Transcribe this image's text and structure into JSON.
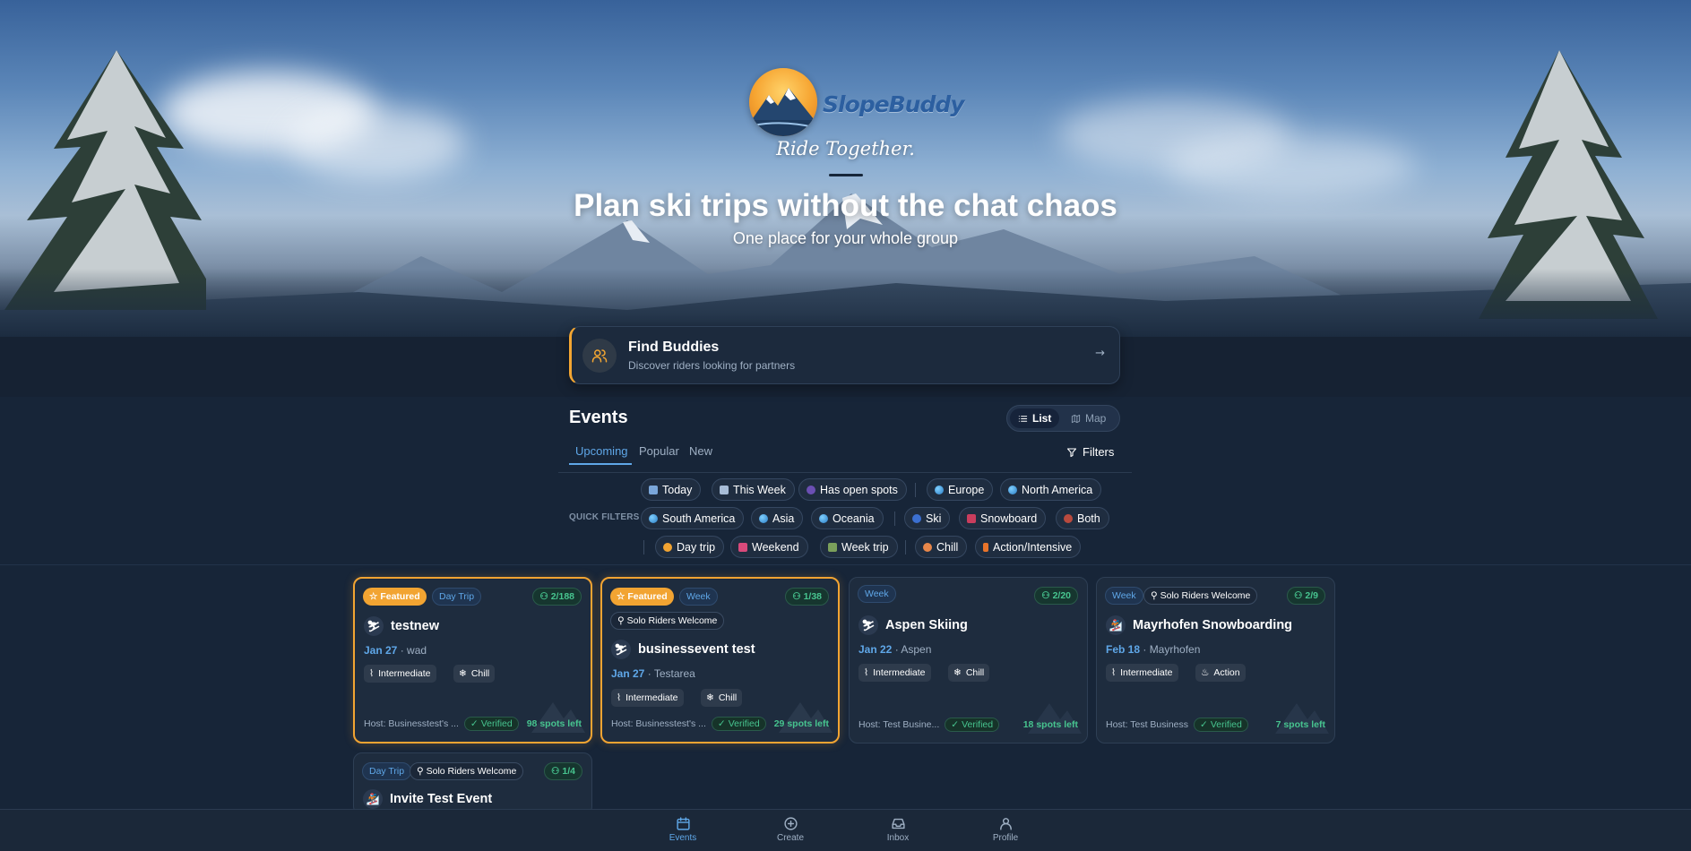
{
  "brand": {
    "name": "SlopeBuddy",
    "tagline": "Ride Together."
  },
  "hero": {
    "headline": "Plan ski trips without the chat chaos",
    "subline": "One place for your whole group"
  },
  "find_buddies": {
    "title": "Find Buddies",
    "subtitle": "Discover riders looking for partners",
    "icon": "users-icon",
    "accent": "#f3a632"
  },
  "events": {
    "heading": "Events",
    "view_toggle": {
      "list": "List",
      "map": "Map",
      "selected": "List"
    },
    "tabs": [
      "Upcoming",
      "Popular",
      "New"
    ],
    "active_tab": "Upcoming",
    "filters_label": "Filters",
    "quick_filters_label": "QUICK FILTERS",
    "quick_filters": {
      "row1": [
        "Today",
        "This Week",
        "Has open spots",
        "Europe",
        "North America"
      ],
      "row2": [
        "South America",
        "Asia",
        "Oceania",
        "Ski",
        "Snowboard",
        "Both"
      ],
      "row3": [
        "Day trip",
        "Weekend",
        "Week trip",
        "Chill",
        "Action/Intensive"
      ]
    }
  },
  "cards": [
    {
      "featured": "Featured",
      "type": "Day Trip",
      "count": "2/188",
      "title": "testnew",
      "date": "Jan 27",
      "location": "wad",
      "level": "Intermediate",
      "vibe": "Chill",
      "host": "Host: Businesstest's ...",
      "verified": "Verified",
      "spots": "98 spots left"
    },
    {
      "featured": "Featured",
      "type": "Week",
      "solo": "Solo Riders Welcome",
      "count": "1/38",
      "title": "businessevent test",
      "date": "Jan 27",
      "location": "Testarea",
      "level": "Intermediate",
      "vibe": "Chill",
      "host": "Host: Businesstest's ...",
      "verified": "Verified",
      "spots": "29 spots left"
    },
    {
      "type": "Week",
      "count": "2/20",
      "title": "Aspen Skiing",
      "date": "Jan 22",
      "location": "Aspen",
      "level": "Intermediate",
      "vibe": "Chill",
      "host": "Host: Test Busine...",
      "verified": "Verified",
      "spots": "18 spots left"
    },
    {
      "type": "Week",
      "solo": "Solo Riders Welcome",
      "count": "2/9",
      "title": "Mayrhofen Snowboarding",
      "date": "Feb 18",
      "location": "Mayrhofen",
      "level": "Intermediate",
      "vibe": "Action",
      "host": "Host: Test Business",
      "verified": "Verified",
      "spots": "7 spots left"
    },
    {
      "type": "Day Trip",
      "solo": "Solo Riders Welcome",
      "count": "1/4",
      "title": "Invite Test Event"
    }
  ],
  "nav": {
    "events": "Events",
    "create": "Create",
    "inbox": "Inbox",
    "profile": "Profile",
    "active": "Events"
  },
  "colors": {
    "accent": "#5fa7e8",
    "featured": "#f2a432",
    "success": "#47c48f",
    "background": "#172538"
  }
}
